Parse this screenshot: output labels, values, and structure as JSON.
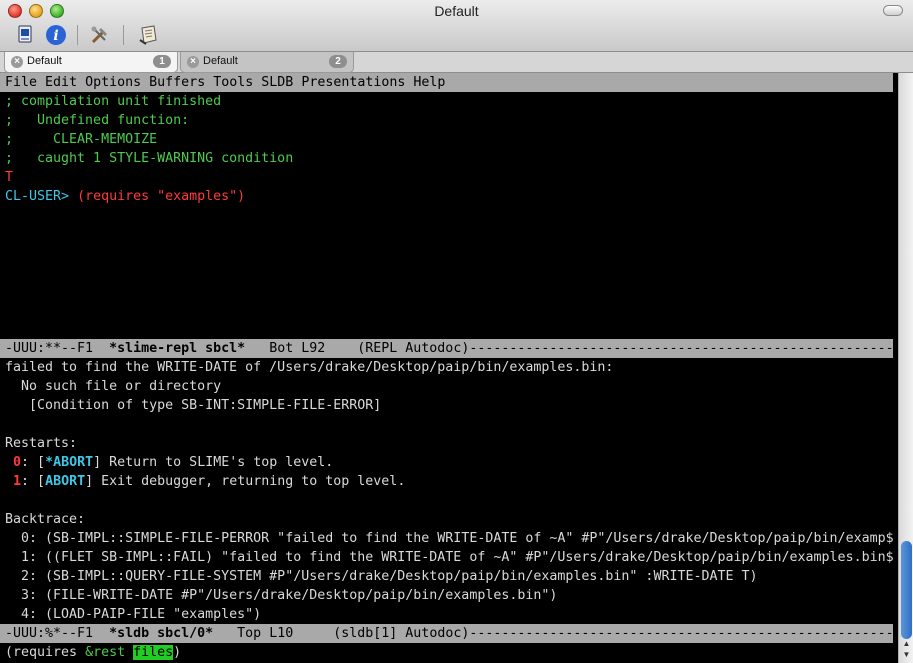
{
  "window": {
    "title": "Default"
  },
  "tabs": [
    {
      "label": "Default",
      "number": "1"
    },
    {
      "label": "Default",
      "number": "2"
    }
  ],
  "menubar": [
    "File",
    "Edit",
    "Options",
    "Buffers",
    "Tools",
    "SLDB",
    "Presentations",
    "Help"
  ],
  "repl": {
    "lines": [
      "; compilation unit finished",
      ";   Undefined function:",
      ";     CLEAR-MEMOIZE",
      ";   caught 1 STYLE-WARNING condition"
    ],
    "result": "T",
    "prompt": "CL-USER>",
    "input": "(requires \"examples\")"
  },
  "modeline1": {
    "status": "-UUU:**--F1  ",
    "buffer": "*slime-repl sbcl*",
    "position": "   Bot L92    ",
    "modes": "(REPL Autodoc)"
  },
  "sldb": {
    "error_lines": [
      "failed to find the WRITE-DATE of /Users/drake/Desktop/paip/bin/examples.bin:",
      "  No such file or directory",
      "   [Condition of type SB-INT:SIMPLE-FILE-ERROR]"
    ],
    "restarts_header": "Restarts:",
    "restarts": [
      {
        "num": "0",
        "name": "*ABORT",
        "text": " Return to SLIME's top level."
      },
      {
        "num": "1",
        "name": "ABORT",
        "text": " Exit debugger, returning to top level."
      }
    ],
    "backtrace_header": "Backtrace:",
    "backtrace": [
      "  0: (SB-IMPL::SIMPLE-FILE-PERROR \"failed to find the WRITE-DATE of ~A\" #P\"/Users/drake/Desktop/paip/bin/examp$",
      "  1: ((FLET SB-IMPL::FAIL) \"failed to find the WRITE-DATE of ~A\" #P\"/Users/drake/Desktop/paip/bin/examples.bin$",
      "  2: (SB-IMPL::QUERY-FILE-SYSTEM #P\"/Users/drake/Desktop/paip/bin/examples.bin\" :WRITE-DATE T)",
      "  3: (FILE-WRITE-DATE #P\"/Users/drake/Desktop/paip/bin/examples.bin\")",
      "  4: (LOAD-PAIP-FILE \"examples\")"
    ]
  },
  "modeline2": {
    "status": "-UUU:%*--F1  ",
    "buffer": "*sldb sbcl/0*",
    "position": "   Top L10     ",
    "modes": "(sldb[1] Autodoc)"
  },
  "minibuffer": {
    "prefix": "(requires ",
    "keyword": "&rest",
    "space": " ",
    "highlight": "files",
    "suffix": ")"
  },
  "colors": {
    "comment": "#4ecb4e",
    "error": "#ff3b3b",
    "prompt": "#3ec7e6",
    "modeline": "#a9a9a9",
    "highlight": "#22cc22"
  }
}
